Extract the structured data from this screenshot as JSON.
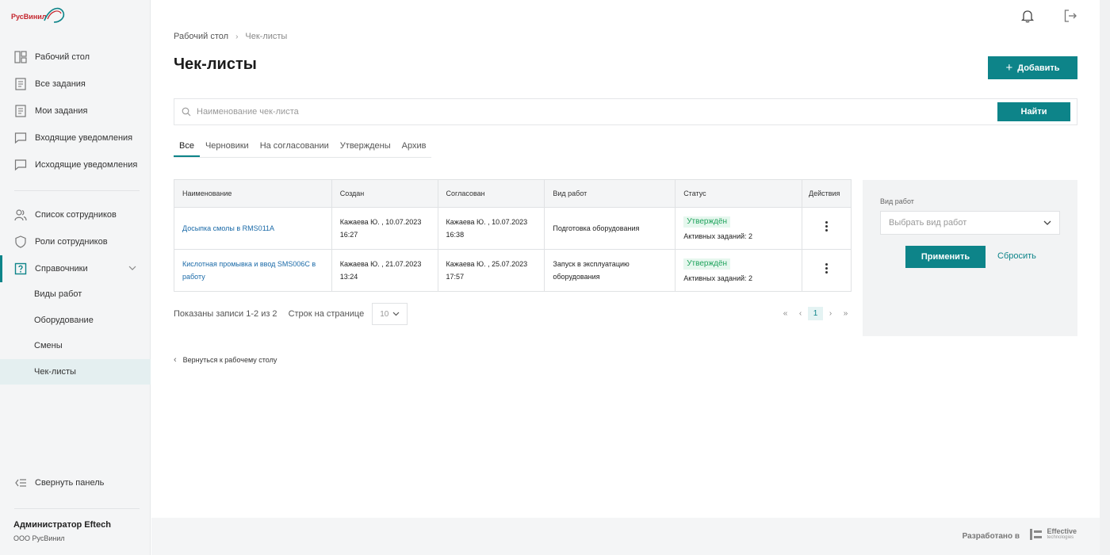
{
  "brand": {
    "name": "РусВинил"
  },
  "sidebar": {
    "items": [
      {
        "label": "Рабочий стол",
        "icon": "dashboard-icon"
      },
      {
        "label": "Все задания",
        "icon": "list-icon"
      },
      {
        "label": "Мои задания",
        "icon": "list-icon"
      },
      {
        "label": "Входящие уведомления",
        "icon": "chat-icon"
      },
      {
        "label": "Исходящие уведомления",
        "icon": "chat-icon"
      },
      {
        "label": "Список сотрудников",
        "icon": "users-icon"
      },
      {
        "label": "Роли сотрудников",
        "icon": "shield-icon"
      },
      {
        "label": "Справочники",
        "icon": "help-book-icon"
      }
    ],
    "subitems": [
      {
        "label": "Виды работ"
      },
      {
        "label": "Оборудование"
      },
      {
        "label": "Смены"
      },
      {
        "label": "Чек-листы"
      }
    ],
    "collapse_label": "Свернуть панель",
    "user": {
      "name": "Администратор Eftech",
      "org": "ООО РусВинил"
    }
  },
  "breadcrumb": {
    "home": "Рабочий стол",
    "current": "Чек-листы"
  },
  "page": {
    "title": "Чек-листы",
    "add_label": "Добавить"
  },
  "search": {
    "placeholder": "Наименование чек-листа",
    "value": "",
    "button": "Найти"
  },
  "tabs": [
    {
      "label": "Все"
    },
    {
      "label": "Черновики"
    },
    {
      "label": "На согласовании"
    },
    {
      "label": "Утверждены"
    },
    {
      "label": "Архив"
    }
  ],
  "table": {
    "columns": [
      "Наименование",
      "Создан",
      "Согласован",
      "Вид работ",
      "Статус",
      "Действия"
    ],
    "rows": [
      {
        "name": "Досыпка смолы в RMS011A",
        "created_by": "Кажаева Ю. , 10.07.2023",
        "created_time": "16:27",
        "approved_by": "Кажаева Ю. , 10.07.2023",
        "approved_time": "16:38",
        "work_type": "Подготовка оборудования",
        "work_type_2": "",
        "status": "Утверждён",
        "active_tasks": "Активных заданий: 2"
      },
      {
        "name": "Кислотная промывка и ввод SMS006C в",
        "name_2": "работу",
        "created_by": "Кажаева Ю. , 21.07.2023",
        "created_time": "13:24",
        "approved_by": "Кажаева Ю. , 25.07.2023",
        "approved_time": "17:57",
        "work_type": "Запуск в эксплуатацию",
        "work_type_2": "оборудования",
        "status": "Утверждён",
        "active_tasks": "Активных заданий: 2"
      }
    ]
  },
  "pagination": {
    "summary": "Показаны записи 1-2 из 2",
    "rows_label": "Строк на странице",
    "rows_value": "10",
    "current_page": "1"
  },
  "back_link": "Вернуться к рабочему столу",
  "filter": {
    "label": "Вид работ",
    "placeholder": "Выбрать вид работ",
    "apply": "Применить",
    "reset": "Сбросить"
  },
  "footer": {
    "text": "Разработано в",
    "logo_line1": "Effective",
    "logo_line2": "technologies"
  },
  "colors": {
    "accent": "#0d8489",
    "status_ok": "#1fa35c",
    "link": "#1a6aa8"
  }
}
